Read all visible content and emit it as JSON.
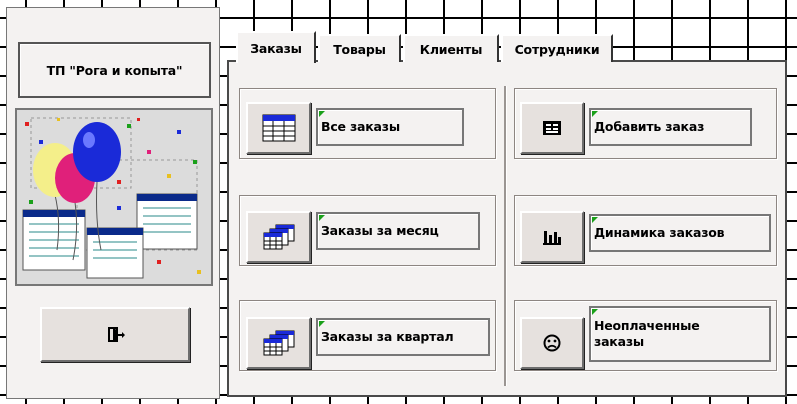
{
  "app": {
    "title": "ТП \"Рога и копыта\""
  },
  "tabs": [
    {
      "label": "Заказы",
      "active": true
    },
    {
      "label": "Товары",
      "active": false
    },
    {
      "label": "Клиенты",
      "active": false
    },
    {
      "label": "Сотрудники",
      "active": false
    }
  ],
  "buttons": {
    "all_orders": "Все заказы",
    "orders_month": "Заказы за месяц",
    "orders_quarter": "Заказы за квартал",
    "add_order": "Добавить заказ",
    "orders_dynamics": "Динамика заказов",
    "unpaid_orders": "Неоплаченные заказы"
  },
  "icons": {
    "exit": "exit-door-icon",
    "all_orders": "table-icon",
    "orders_month": "multi-table-icon",
    "orders_quarter": "multi-table-icon",
    "add_order": "form-icon",
    "orders_dynamics": "bar-chart-icon",
    "unpaid_orders": "sad-face-icon"
  },
  "colors": {
    "background": "#ffffff",
    "panel": "#f4f2f1",
    "button_face": "#e6e1de",
    "caption_marker": "#1aa01a"
  }
}
